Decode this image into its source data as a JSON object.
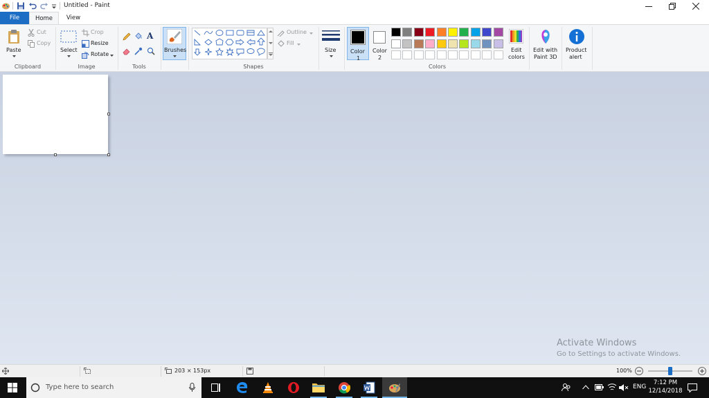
{
  "window": {
    "title": "Untitled - Paint"
  },
  "tabs": [
    {
      "label": "File"
    },
    {
      "label": "Home"
    },
    {
      "label": "View"
    }
  ],
  "clipboard": {
    "paste": "Paste",
    "cut": "Cut",
    "copy": "Copy",
    "group": "Clipboard"
  },
  "image": {
    "select": "Select",
    "crop": "Crop",
    "resize": "Resize",
    "rotate": "Rotate",
    "group": "Image"
  },
  "tools": {
    "group": "Tools",
    "text_glyph": "A"
  },
  "brushes": {
    "label": "Brushes"
  },
  "shapes": {
    "group": "Shapes",
    "outline": "Outline",
    "fill": "Fill"
  },
  "size": {
    "label": "Size"
  },
  "colors": {
    "color1": "Color",
    "color1_num": "1",
    "color2": "Color",
    "color2_num": "2",
    "edit_line1": "Edit",
    "edit_line2": "colors",
    "group": "Colors",
    "primary": "#000000",
    "secondary": "#ffffff",
    "row1": [
      "#000000",
      "#7f7f7f",
      "#880015",
      "#ed1c24",
      "#ff7f27",
      "#fff200",
      "#22b14c",
      "#00a2e8",
      "#3f48cc",
      "#a349a4"
    ],
    "row2": [
      "#ffffff",
      "#c3c3c3",
      "#b97a57",
      "#ffaec9",
      "#ffc90e",
      "#efe4b0",
      "#b5e61d",
      "#99d9ea",
      "#7092be",
      "#c8bfe7"
    ],
    "row3": [
      "#ffffff",
      "#ffffff",
      "#ffffff",
      "#ffffff",
      "#ffffff",
      "#ffffff",
      "#ffffff",
      "#ffffff",
      "#ffffff",
      "#ffffff"
    ]
  },
  "paint3d": {
    "line1": "Edit with",
    "line2": "Paint 3D"
  },
  "product_alert": {
    "line1": "Product",
    "line2": "alert"
  },
  "watermark": {
    "line1": "Activate Windows",
    "line2": "Go to Settings to activate Windows."
  },
  "status": {
    "canvas_size": "203 × 153px",
    "zoom": "100%",
    "zoom_level": 0.5
  },
  "taskbar": {
    "search_placeholder": "Type here to search",
    "language": "ENG",
    "time": "7:12 PM",
    "date": "12/14/2018"
  }
}
